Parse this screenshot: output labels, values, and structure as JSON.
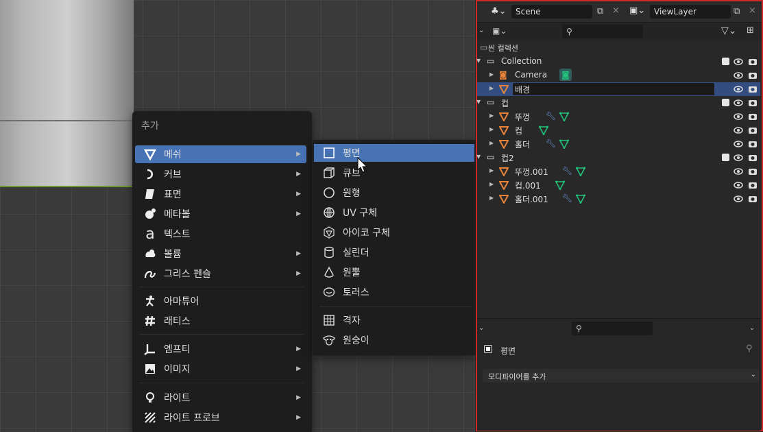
{
  "add_menu": {
    "title": "추가",
    "items": [
      {
        "label": "메쉬",
        "icon": "mesh-icon",
        "has_submenu": true,
        "active": true
      },
      {
        "label": "커브",
        "icon": "curve-icon",
        "has_submenu": true
      },
      {
        "label": "표면",
        "icon": "surface-icon",
        "has_submenu": true
      },
      {
        "label": "메타볼",
        "icon": "metaball-icon",
        "has_submenu": true
      },
      {
        "label": "텍스트",
        "icon": "text-icon",
        "has_submenu": false
      },
      {
        "label": "볼륨",
        "icon": "volume-icon",
        "has_submenu": true
      },
      {
        "label": "그리스 펜슬",
        "icon": "grease-pencil-icon",
        "has_submenu": true
      },
      {
        "label": "아마튜어",
        "icon": "armature-icon",
        "has_submenu": false
      },
      {
        "label": "래티스",
        "icon": "lattice-icon",
        "has_submenu": false
      },
      {
        "label": "엠프티",
        "icon": "empty-icon",
        "has_submenu": true
      },
      {
        "label": "이미지",
        "icon": "image-icon",
        "has_submenu": true
      },
      {
        "label": "라이트",
        "icon": "light-icon",
        "has_submenu": true
      },
      {
        "label": "라이트 프로브",
        "icon": "light-probe-icon",
        "has_submenu": true
      }
    ]
  },
  "mesh_submenu": {
    "items": [
      {
        "label": "평면",
        "icon": "plane-icon",
        "active": true
      },
      {
        "label": "큐브",
        "icon": "cube-icon"
      },
      {
        "label": "원형",
        "icon": "circle-icon"
      },
      {
        "label": "UV 구체",
        "icon": "uv-sphere-icon"
      },
      {
        "label": "아이코 구체",
        "icon": "ico-sphere-icon"
      },
      {
        "label": "실린더",
        "icon": "cylinder-icon"
      },
      {
        "label": "원뿔",
        "icon": "cone-icon"
      },
      {
        "label": "토러스",
        "icon": "torus-icon"
      },
      {
        "label": "격자",
        "icon": "grid-icon"
      },
      {
        "label": "원숭이",
        "icon": "monkey-icon"
      }
    ]
  },
  "outliner": {
    "scene_label": "Scene",
    "view_layer_label": "ViewLayer",
    "search_placeholder": "",
    "scene_collection_label": "씬 컬렉션",
    "rows": [
      {
        "label": "Collection",
        "type": "collection",
        "depth": 0
      },
      {
        "label": "Camera",
        "type": "camera",
        "depth": 1
      },
      {
        "label": "배경",
        "type": "mesh",
        "depth": 1,
        "selected": true,
        "editing": true
      },
      {
        "label": "컵",
        "type": "collection",
        "depth": 0
      },
      {
        "label": "뚜껑",
        "type": "mesh",
        "depth": 1,
        "modifier": true
      },
      {
        "label": "컵",
        "type": "mesh",
        "depth": 1
      },
      {
        "label": "홀더",
        "type": "mesh",
        "depth": 1,
        "modifier": true
      },
      {
        "label": "컵2",
        "type": "collection",
        "depth": 0
      },
      {
        "label": "뚜껑.001",
        "type": "mesh",
        "depth": 1,
        "modifier": true
      },
      {
        "label": "컵.001",
        "type": "mesh",
        "depth": 1
      },
      {
        "label": "홀더.001",
        "type": "mesh",
        "depth": 1,
        "modifier": true
      }
    ]
  },
  "properties": {
    "object_name": "평면",
    "add_modifier_label": "모디파이어를 추가"
  },
  "colors": {
    "accent": "#4772b3",
    "mesh_orange": "#e8843a",
    "modifier_blue": "#6f8fd8",
    "vertex_green": "#22c07a",
    "highlight_border": "#d4262a"
  }
}
